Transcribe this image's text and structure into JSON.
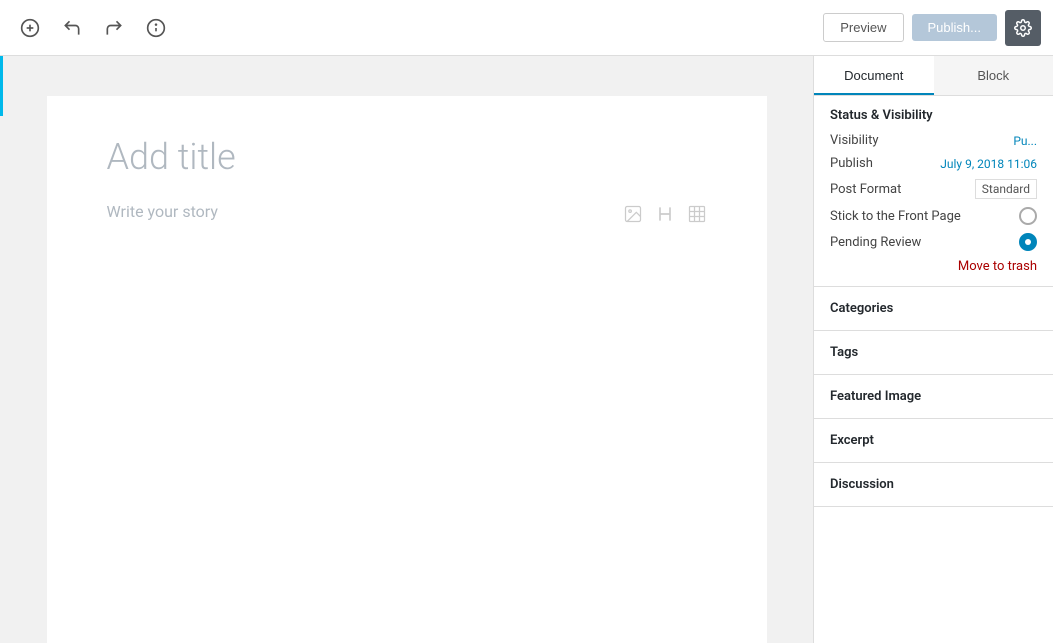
{
  "toolbar": {
    "add_label": "+",
    "undo_label": "undo",
    "redo_label": "redo",
    "info_label": "info",
    "preview_label": "Preview",
    "publish_label": "Publish...",
    "settings_label": "Settings"
  },
  "editor": {
    "title_placeholder": "Add title",
    "body_placeholder": "Write your story"
  },
  "sidebar": {
    "tab_document": "Document",
    "tab_block": "Block",
    "status_visibility_title": "Status & Visibility",
    "visibility_label": "Visibility",
    "visibility_value": "Pu...",
    "publish_label": "Publish",
    "publish_value": "July 9, 2018 11:06",
    "post_format_label": "Post Format",
    "post_format_value": "Standard",
    "stick_label": "Stick to the Front Page",
    "pending_review_label": "Pending Review",
    "move_to_trash_label": "Move to trash",
    "categories_title": "Categories",
    "tags_title": "Tags",
    "featured_image_title": "Featured Image",
    "excerpt_title": "Excerpt",
    "discussion_title": "Discussion"
  }
}
